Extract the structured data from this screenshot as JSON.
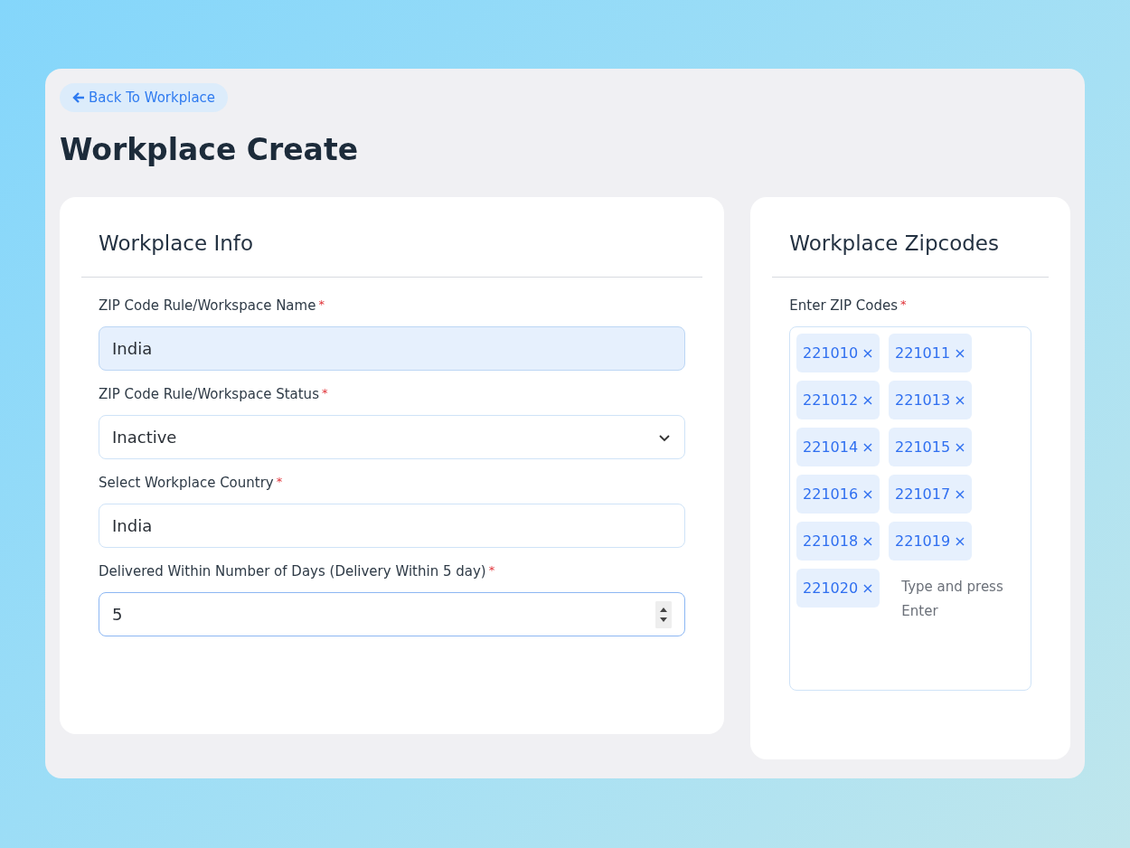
{
  "back_link": {
    "label": "Back To Workplace"
  },
  "page_title": "Workplace Create",
  "info_card": {
    "title": "Workplace Info",
    "fields": [
      {
        "kind": "text",
        "label": "ZIP Code Rule/Workspace Name",
        "required_mark": "*",
        "value": "India",
        "autofilled": true,
        "focused": false
      },
      {
        "kind": "select",
        "label": "ZIP Code Rule/Workspace Status",
        "required_mark": "*",
        "value": "Inactive",
        "autofilled": false,
        "focused": false
      },
      {
        "kind": "text",
        "label": "Select Workplace Country",
        "required_mark": "*",
        "value": "India",
        "autofilled": false,
        "focused": false
      },
      {
        "kind": "number",
        "label": "Delivered Within Number of Days (Delivery Within 5 day)",
        "required_mark": "*",
        "value": "5",
        "autofilled": false,
        "focused": true
      }
    ]
  },
  "zip_card": {
    "title": "Workplace Zipcodes",
    "label": "Enter ZIP Codes",
    "required_mark": "*",
    "placeholder": "Type and press Enter",
    "chips": [
      {
        "code": "221010",
        "remove": "×"
      },
      {
        "code": "221011",
        "remove": "×"
      },
      {
        "code": "221012",
        "remove": "×"
      },
      {
        "code": "221013",
        "remove": "×"
      },
      {
        "code": "221014",
        "remove": "×"
      },
      {
        "code": "221015",
        "remove": "×"
      },
      {
        "code": "221016",
        "remove": "×"
      },
      {
        "code": "221017",
        "remove": "×"
      },
      {
        "code": "221018",
        "remove": "×"
      },
      {
        "code": "221019",
        "remove": "×"
      },
      {
        "code": "221020",
        "remove": "×"
      }
    ]
  }
}
